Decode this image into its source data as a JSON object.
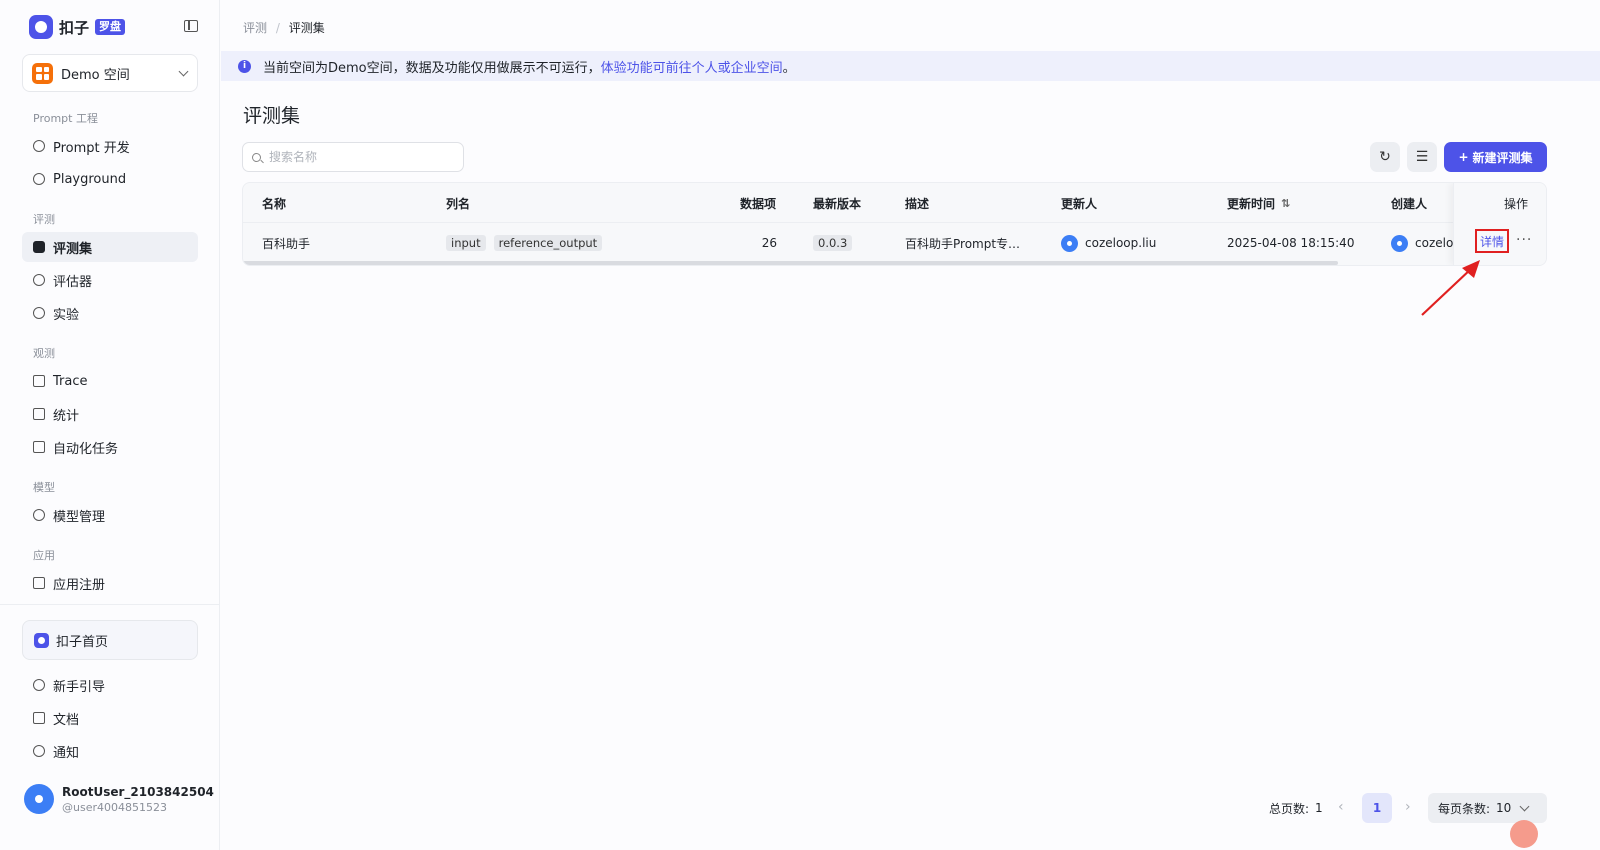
{
  "app": {
    "logo_text": "扣子",
    "logo_tag": "罗盘"
  },
  "space": {
    "name": "Demo 空间"
  },
  "sidebar": {
    "groups": {
      "prompt": "Prompt 工程",
      "eval": "评测",
      "observe": "观测",
      "model": "模型",
      "app": "应用"
    },
    "items": [
      {
        "label": "Prompt 开发",
        "icon": "chat-icon"
      },
      {
        "label": "Playground",
        "icon": "play-icon"
      },
      {
        "label": "评测集",
        "icon": "database-icon",
        "active": true
      },
      {
        "label": "评估器",
        "icon": "evaluator-icon"
      },
      {
        "label": "实验",
        "icon": "experiment-icon"
      },
      {
        "label": "Trace",
        "icon": "trace-icon"
      },
      {
        "label": "统计",
        "icon": "chart-icon"
      },
      {
        "label": "自动化任务",
        "icon": "task-icon"
      },
      {
        "label": "模型管理",
        "icon": "model-icon"
      },
      {
        "label": "应用注册",
        "icon": "cube-icon"
      }
    ],
    "home_button": "扣子首页",
    "bottom_items": [
      {
        "label": "新手引导",
        "icon": "help-icon"
      },
      {
        "label": "文档",
        "icon": "doc-icon"
      },
      {
        "label": "通知",
        "icon": "bell-icon"
      }
    ],
    "user": {
      "name": "RootUser_2103842504",
      "handle": "@user4004851523"
    }
  },
  "breadcrumb": {
    "parent": "评测",
    "sep": "/",
    "current": "评测集"
  },
  "banner": {
    "text": "当前空间为Demo空间，数据及功能仅用做展示不可运行，",
    "link": "体验功能可前往个人或企业空间",
    "suffix": "。"
  },
  "page": {
    "title": "评测集"
  },
  "search": {
    "placeholder": "搜索名称",
    "value": ""
  },
  "toolbar": {
    "new_label": "新建评测集"
  },
  "table": {
    "columns": [
      "名称",
      "列名",
      "数据项",
      "最新版本",
      "描述",
      "更新人",
      "更新时间",
      "创建人",
      "操作"
    ],
    "rows": [
      {
        "name": "百科助手",
        "columns": [
          "input",
          "reference_output"
        ],
        "count": "26",
        "version": "0.0.3",
        "description": "百科助手Prompt专…",
        "updater": "cozeloop.liu",
        "updated_at": "2025-04-08 18:15:40",
        "creator": "cozeloc",
        "action_detail": "详情",
        "action_more": "···"
      }
    ]
  },
  "pagination": {
    "total_label": "总页数:",
    "total": "1",
    "current": "1",
    "per_page_label": "每页条数:",
    "per_page": "10"
  },
  "colors": {
    "accent": "#4d53e8",
    "highlight": "#e02020"
  }
}
